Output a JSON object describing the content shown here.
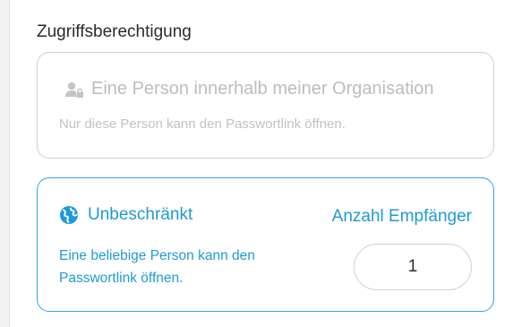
{
  "section": {
    "title": "Zugriffsberechtigung"
  },
  "options": {
    "restricted": {
      "title": "Eine Person innerhalb meiner Organisation",
      "description": "Nur diese Person kann den Passwortlink öffnen.",
      "icon": "user-lock-icon"
    },
    "unrestricted": {
      "title": "Unbeschränkt",
      "description": "Eine beliebige Person kann den Passwortlink öffnen.",
      "icon": "globe-icon",
      "selected": true
    }
  },
  "recipients": {
    "label": "Anzahl Empfänger",
    "value": "1"
  },
  "colors": {
    "accent": "#1f9ad6",
    "accent_border": "#2aa7e6",
    "disabled_text": "#bdbdbd",
    "card_border": "#cfcfcf"
  }
}
